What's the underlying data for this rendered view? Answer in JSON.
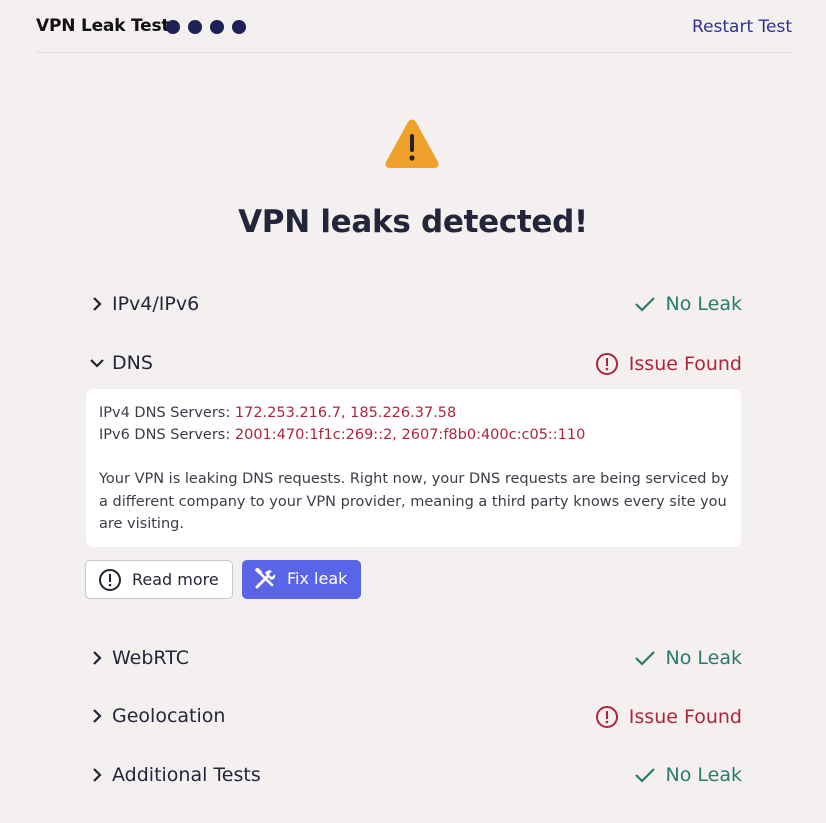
{
  "header": {
    "title": "VPN Leak Test",
    "progress_dots": 4,
    "restart_label": "Restart Test"
  },
  "result": {
    "headline": "VPN leaks detected!",
    "icon": "warning-triangle-icon"
  },
  "tests": [
    {
      "name": "IPv4/IPv6",
      "status": "No Leak",
      "state": "ok",
      "expanded": false
    },
    {
      "name": "DNS",
      "status": "Issue Found",
      "state": "issue",
      "expanded": true
    },
    {
      "name": "WebRTC",
      "status": "No Leak",
      "state": "ok",
      "expanded": false
    },
    {
      "name": "Geolocation",
      "status": "Issue Found",
      "state": "issue",
      "expanded": false
    },
    {
      "name": "Additional Tests",
      "status": "No Leak",
      "state": "ok",
      "expanded": false
    }
  ],
  "dns_details": {
    "ipv4_label": "IPv4 DNS Servers: ",
    "ipv4_value": "172.253.216.7, 185.226.37.58",
    "ipv6_label": "IPv6 DNS Servers: ",
    "ipv6_value": "2001:470:1f1c:269::2, 2607:f8b0:400c:c05::110",
    "description": "Your VPN is leaking DNS requests. Right now, your DNS requests are being serviced by a different company to your VPN provider, meaning a third party knows every site you are visiting.",
    "read_more_label": "Read more",
    "fix_leak_label": "Fix leak"
  },
  "colors": {
    "background": "#f4f0ef",
    "ok": "#2b7a6f",
    "issue": "#b0243b",
    "accent": "#5a64e6",
    "warning": "#f0a12c",
    "dots": "#1e2058"
  }
}
